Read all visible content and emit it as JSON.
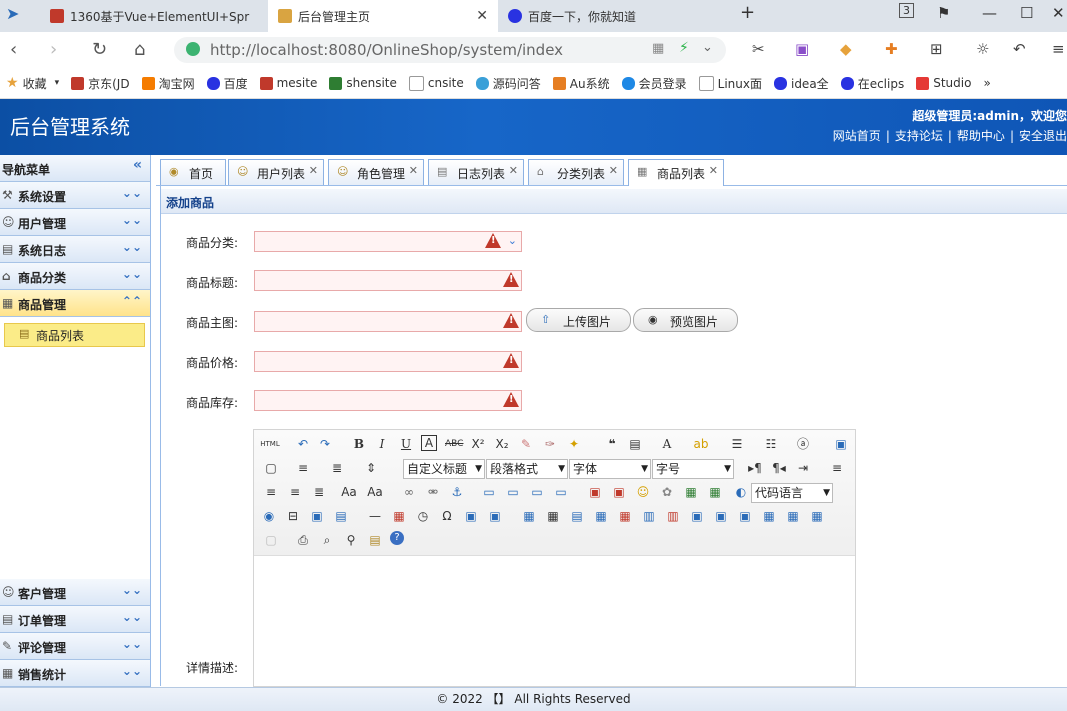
{
  "browser": {
    "tabs": [
      {
        "title": "1360基于Vue+ElementUI+Spr",
        "favicon_color": "#c0392b"
      },
      {
        "title": "后台管理主页",
        "favicon_color": "#b8860b"
      },
      {
        "title": "百度一下，你就知道",
        "favicon_color": "#2932e1"
      }
    ],
    "new_tab": "+",
    "tab_count": "3",
    "url": "http://localhost:8080/OnlineShop/system/index",
    "bookmarks": [
      "收藏",
      "京东(JD",
      "淘宝网",
      "百度",
      "mesite",
      "shensite",
      "cnsite",
      "源码问答",
      "Au系统",
      "会员登录",
      "Linux面",
      "idea全",
      "在eclips",
      "Studio"
    ],
    "bookmark_more": "»"
  },
  "app": {
    "title": "后台管理系统",
    "welcome": "超级管理员:admin，欢迎您",
    "top_links": [
      "网站首页",
      "支持论坛",
      "帮助中心",
      "安全退出"
    ]
  },
  "sidebar": {
    "title": "导航菜单",
    "collapse": "«",
    "groups_top": [
      {
        "label": "系统设置",
        "icon": "⚒"
      },
      {
        "label": "用户管理",
        "icon": "☺"
      },
      {
        "label": "系统日志",
        "icon": "▤"
      },
      {
        "label": "商品分类",
        "icon": "⌂"
      },
      {
        "label": "商品管理",
        "icon": "▦"
      }
    ],
    "active_item": "商品列表",
    "groups_bottom": [
      {
        "label": "客户管理",
        "icon": "☺"
      },
      {
        "label": "订单管理",
        "icon": "▤"
      },
      {
        "label": "评论管理",
        "icon": "✎"
      },
      {
        "label": "销售统计",
        "icon": "▦"
      }
    ]
  },
  "tabs": [
    {
      "label": "首页",
      "closable": false
    },
    {
      "label": "用户列表",
      "closable": true
    },
    {
      "label": "角色管理",
      "closable": true
    },
    {
      "label": "日志列表",
      "closable": true
    },
    {
      "label": "分类列表",
      "closable": true
    },
    {
      "label": "商品列表",
      "closable": true
    }
  ],
  "panel": {
    "title": "添加商品",
    "fields": {
      "category": "商品分类:",
      "title": "商品标题:",
      "image": "商品主图:",
      "price": "商品价格:",
      "stock": "商品库存:",
      "detail": "详情描述:"
    },
    "upload_button": "上传图片",
    "preview_button": "预览图片"
  },
  "editor": {
    "selects": [
      "自定义标题",
      "段落格式",
      "字体",
      "字号",
      "代码语言"
    ],
    "html_btn": "HTML"
  },
  "footer": "© 2022 【】 All Rights Reserved"
}
